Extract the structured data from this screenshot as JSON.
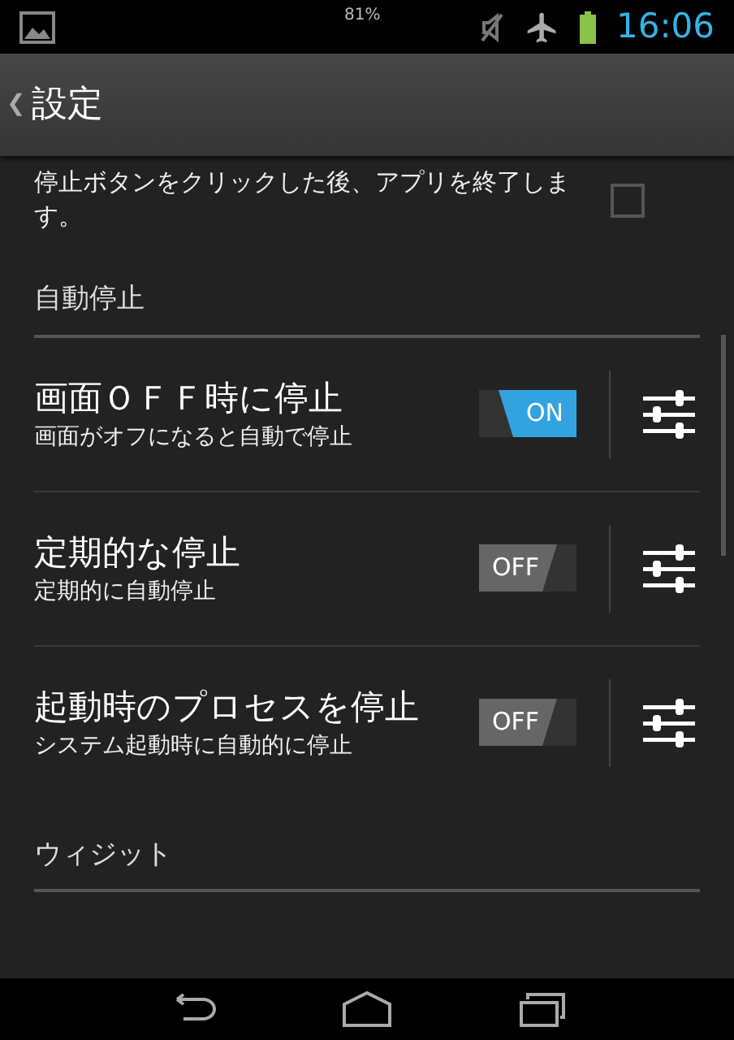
{
  "status_bar": {
    "battery_percent": "81%",
    "time": "16:06"
  },
  "action_bar": {
    "back": "❮",
    "title": "設定"
  },
  "top_item": {
    "description": "停止ボタンをクリックした後、アプリを終了します。",
    "checked": false
  },
  "sections": [
    {
      "header": "自動停止",
      "items": [
        {
          "title": "画面ＯＦＦ時に停止",
          "description": "画面がオフになると自動で停止",
          "on": true,
          "toggle_label": "ON"
        },
        {
          "title": "定期的な停止",
          "description": "定期的に自動停止",
          "on": false,
          "toggle_label": "OFF"
        },
        {
          "title": "起動時のプロセスを停止",
          "description": "システム起動時に自動的に停止",
          "on": false,
          "toggle_label": "OFF"
        }
      ]
    },
    {
      "header": "ウィジット"
    }
  ]
}
